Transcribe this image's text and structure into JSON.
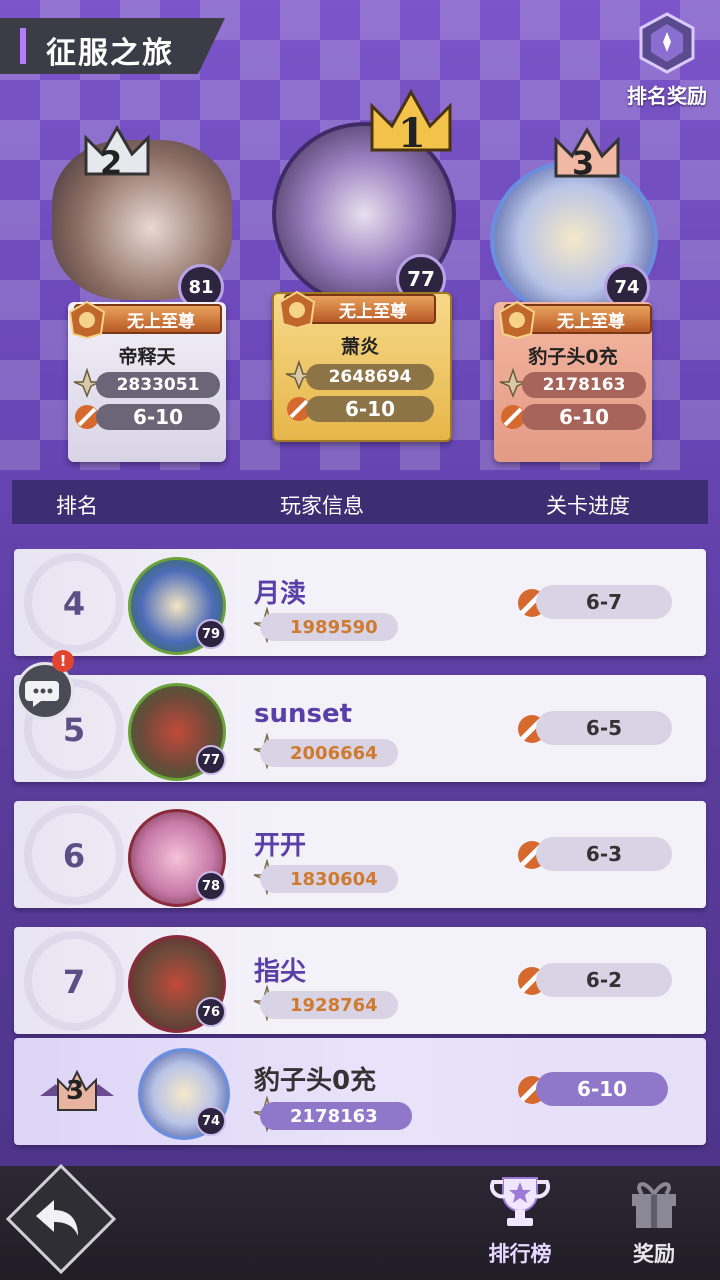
{
  "header": {
    "title": "征服之旅",
    "reward_label": "排名奖励"
  },
  "podium": [
    {
      "place": "2",
      "level": "81",
      "title": "无上至尊",
      "name": "帝释天",
      "power": "2833051",
      "stage": "6-10"
    },
    {
      "place": "1",
      "level": "77",
      "title": "无上至尊",
      "name": "萧炎",
      "power": "2648694",
      "stage": "6-10"
    },
    {
      "place": "3",
      "level": "74",
      "title": "无上至尊",
      "name": "豹子头0充",
      "power": "2178163",
      "stage": "6-10"
    }
  ],
  "columns": {
    "rank": "排名",
    "player": "玩家信息",
    "progress": "关卡进度"
  },
  "rows": [
    {
      "rank": "4",
      "level": "79",
      "name": "月渎",
      "power": "1989590",
      "stage": "6-7"
    },
    {
      "rank": "5",
      "level": "77",
      "name": "sunset",
      "power": "2006664",
      "stage": "6-5"
    },
    {
      "rank": "6",
      "level": "78",
      "name": "开开",
      "power": "1830604",
      "stage": "6-3"
    },
    {
      "rank": "7",
      "level": "76",
      "name": "指尖",
      "power": "1928764",
      "stage": "6-2"
    }
  ],
  "self": {
    "rank": "3",
    "level": "74",
    "name": "豹子头0充",
    "power": "2178163",
    "stage": "6-10"
  },
  "chat": {
    "alert": "!"
  },
  "tabs": [
    {
      "label": "排行榜"
    },
    {
      "label": "奖励"
    }
  ],
  "colors": {
    "accent": "#b57cff",
    "gold": "#f3c24a",
    "active_tab": "#e7d6ff"
  }
}
